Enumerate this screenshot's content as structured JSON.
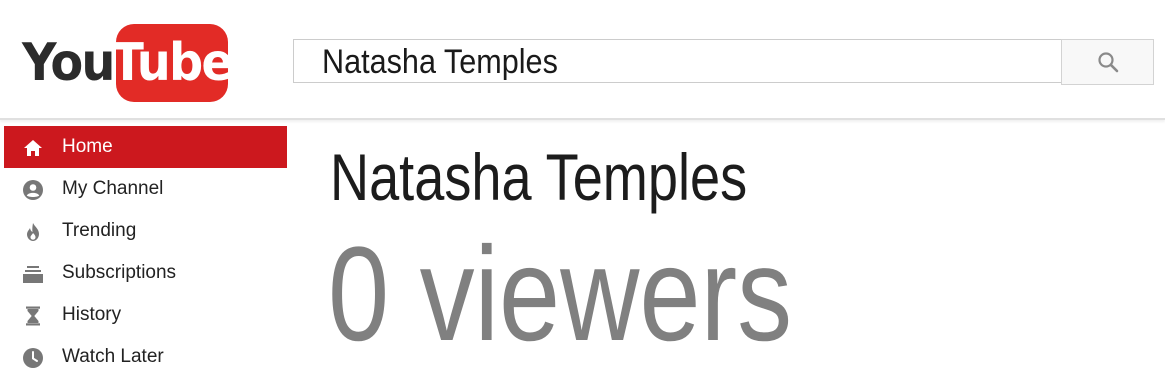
{
  "logo": {
    "part1": "You",
    "part2": "Tube"
  },
  "search": {
    "value": "Natasha Temples",
    "button_icon": "search-icon"
  },
  "sidebar": {
    "items": [
      {
        "label": "Home",
        "icon": "home-icon",
        "active": true
      },
      {
        "label": "My Channel",
        "icon": "account-icon",
        "active": false
      },
      {
        "label": "Trending",
        "icon": "flame-icon",
        "active": false
      },
      {
        "label": "Subscriptions",
        "icon": "subscriptions-icon",
        "active": false
      },
      {
        "label": "History",
        "icon": "hourglass-icon",
        "active": false
      },
      {
        "label": "Watch Later",
        "icon": "clock-icon",
        "active": false
      }
    ]
  },
  "main": {
    "title": "Natasha Temples",
    "viewers": "0 viewers"
  },
  "colors": {
    "brand_red": "#e22b26",
    "active_nav": "#cc181e",
    "viewers_gray": "#808080"
  }
}
